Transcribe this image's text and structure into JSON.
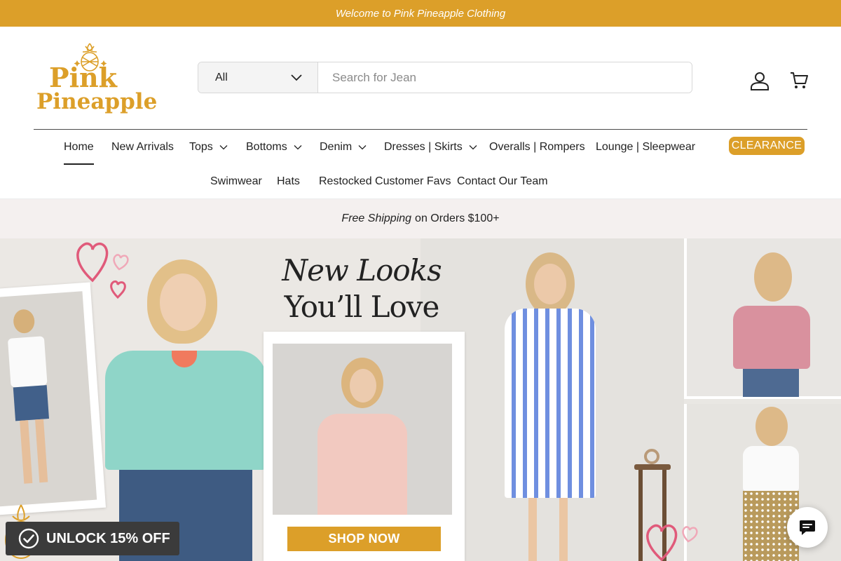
{
  "announcement": {
    "text": "Welcome to Pink Pineapple Clothing"
  },
  "brand": {
    "line1": "Pink",
    "line2": "Pineapple",
    "color": "#dc9f29"
  },
  "search": {
    "category": "All",
    "placeholder": "Search for Jean"
  },
  "header_icons": [
    "account-icon",
    "cart-icon"
  ],
  "nav": {
    "row1": [
      {
        "label": "Home",
        "dropdown": false,
        "active": true
      },
      {
        "label": "New Arrivals",
        "dropdown": false
      },
      {
        "label": "Tops",
        "dropdown": true
      },
      {
        "label": "Bottoms",
        "dropdown": true
      },
      {
        "label": "Denim",
        "dropdown": true
      },
      {
        "label": "Dresses | Skirts",
        "dropdown": true
      },
      {
        "label": "Overalls | Rompers",
        "dropdown": false
      },
      {
        "label": "Lounge | Sleepwear",
        "dropdown": false
      }
    ],
    "clearance": "CLEARANCE",
    "row2": [
      {
        "label": "Swimwear"
      },
      {
        "label": "Hats"
      },
      {
        "label": "Restocked Customer Favs"
      },
      {
        "label": "Contact Our Team"
      }
    ]
  },
  "shipping": {
    "emphasis": "Free Shipping",
    "rest": "on Orders $100+"
  },
  "hero": {
    "title_line1": "New Looks",
    "title_line2": "You’ll Love",
    "cta": "SHOP NOW"
  },
  "popup": {
    "unlock": "UNLOCK 15% OFF"
  },
  "colors": {
    "accent": "#dc9f29",
    "dark": "#222222",
    "heart": "#e05a7a"
  }
}
